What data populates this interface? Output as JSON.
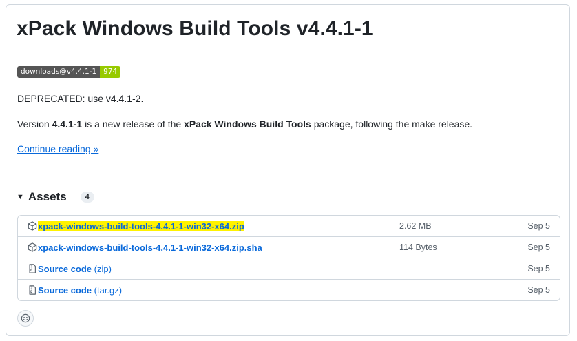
{
  "release": {
    "title": "xPack Windows Build Tools v4.4.1-1",
    "badge": {
      "label": "downloads@v4.4.1-1",
      "value": "974",
      "value_color": "#97ca00"
    },
    "deprecated_text": "DEPRECATED: use v4.4.1-2.",
    "body": {
      "prefix": "Version ",
      "version": "4.4.1-1",
      "mid": " is a new release of the ",
      "package": "xPack Windows Build Tools",
      "suffix": " package, following the make release."
    },
    "continue_link": "Continue reading »"
  },
  "assets": {
    "title": "Assets",
    "count": "4",
    "items": [
      {
        "icon": "package-icon",
        "name": "xpack-windows-build-tools-4.4.1-1-win32-x64.zip",
        "suffix": "",
        "size": "2.62 MB",
        "date": "Sep 5",
        "highlighted": true
      },
      {
        "icon": "package-icon",
        "name": "xpack-windows-build-tools-4.4.1-1-win32-x64.zip.sha",
        "suffix": "",
        "size": "114 Bytes",
        "date": "Sep 5",
        "highlighted": false
      },
      {
        "icon": "file-zip-icon",
        "name": "Source code",
        "suffix": " (zip)",
        "size": "",
        "date": "Sep 5",
        "highlighted": false
      },
      {
        "icon": "file-zip-icon",
        "name": "Source code",
        "suffix": " (tar.gz)",
        "size": "",
        "date": "Sep 5",
        "highlighted": false
      }
    ]
  },
  "colors": {
    "link": "#0969da",
    "highlight": "#fff200",
    "border": "#d0d7de"
  }
}
